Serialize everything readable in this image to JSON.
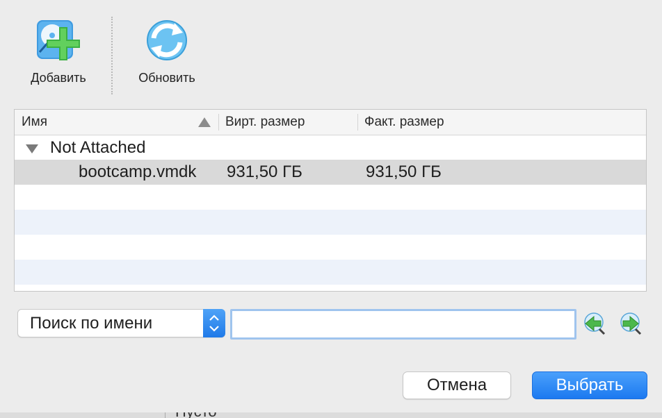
{
  "toolbar": {
    "add_label": "Добавить",
    "refresh_label": "Обновить"
  },
  "table": {
    "columns": [
      "Имя",
      "Вирт. размер",
      "Факт. размер"
    ],
    "sort_column": "Имя",
    "sort_direction": "ascending",
    "groups": [
      {
        "label": "Not Attached",
        "expanded": true,
        "rows": [
          {
            "name": "bootcamp.vmdk",
            "virtual_size": "931,50 ГБ",
            "actual_size": "931,50 ГБ",
            "selected": true
          }
        ]
      }
    ]
  },
  "search": {
    "mode_selected": "Поиск по имени",
    "value": ""
  },
  "buttons": {
    "cancel": "Отмена",
    "choose": "Выбрать"
  },
  "background_peek_text": "Пусто",
  "colors": {
    "accent": "#1f7ae8",
    "selected_row": "#d9d9d9",
    "alt_row": "#edf2fa"
  }
}
